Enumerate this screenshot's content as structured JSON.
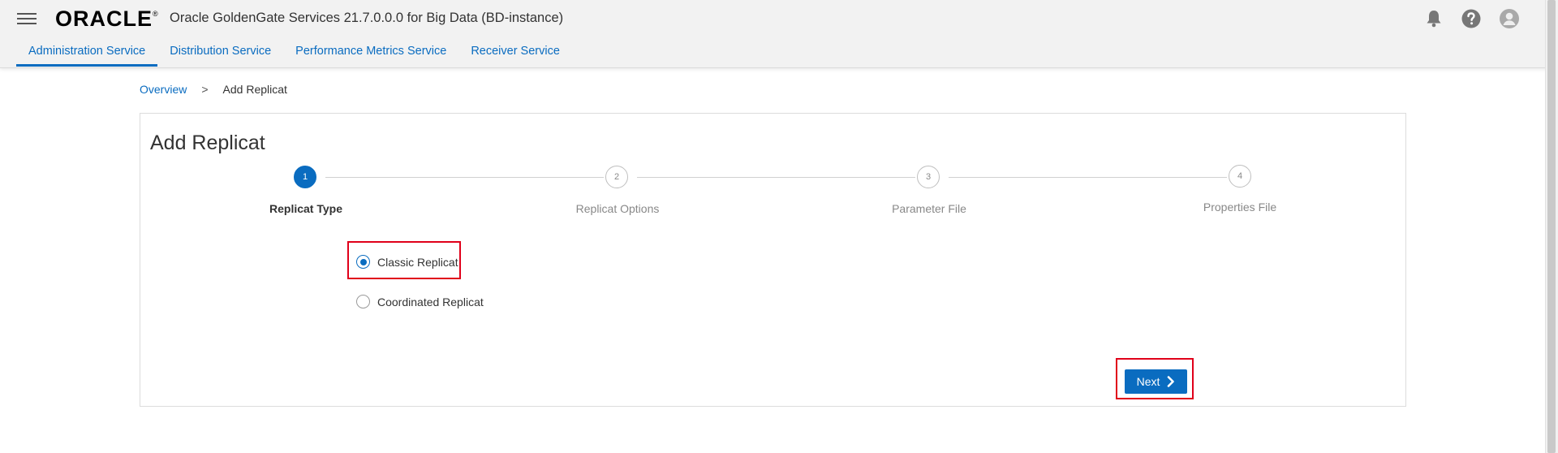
{
  "header": {
    "logo_text": "ORACLE",
    "logo_mark": "®",
    "app_title": "Oracle GoldenGate Services 21.7.0.0.0 for Big Data (BD-instance)",
    "icons": [
      "menu-icon",
      "bell-icon",
      "help-icon",
      "user-avatar-icon"
    ]
  },
  "tabs": [
    {
      "label": "Administration Service",
      "active": true
    },
    {
      "label": "Distribution Service",
      "active": false
    },
    {
      "label": "Performance Metrics Service",
      "active": false
    },
    {
      "label": "Receiver Service",
      "active": false
    }
  ],
  "breadcrumb": {
    "parent": "Overview",
    "separator": ">",
    "current": "Add Replicat"
  },
  "wizard": {
    "title": "Add Replicat",
    "steps": [
      {
        "number": "1",
        "label": "Replicat Type",
        "active": true
      },
      {
        "number": "2",
        "label": "Replicat Options",
        "active": false
      },
      {
        "number": "3",
        "label": "Parameter File",
        "active": false
      },
      {
        "number": "4",
        "label": "Properties File",
        "active": false
      }
    ],
    "options": [
      {
        "label": "Classic Replicat",
        "selected": true
      },
      {
        "label": "Coordinated Replicat",
        "selected": false
      }
    ],
    "next_label": "Next"
  },
  "colors": {
    "accent": "#0a6cc0",
    "highlight": "#e0001a",
    "header_bg": "#f2f2f2"
  }
}
